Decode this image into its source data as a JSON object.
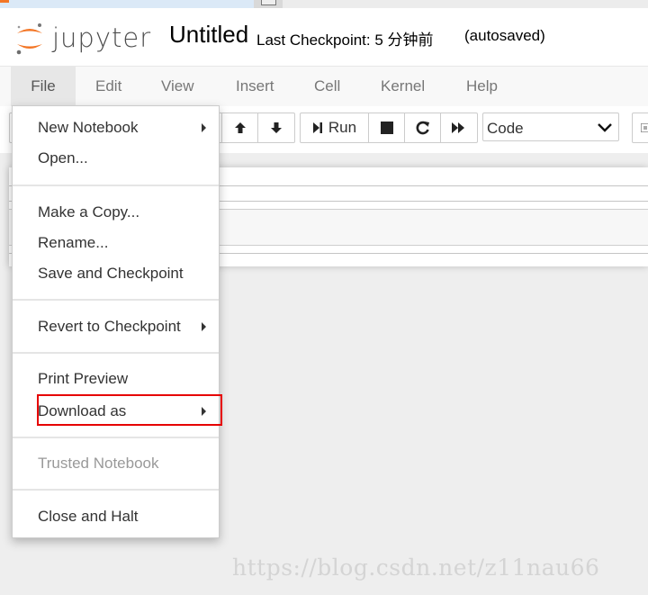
{
  "header": {
    "logo_text": "jupyter",
    "notebook_title": "Untitled",
    "checkpoint_status": "Last Checkpoint: 5 分钟前",
    "autosave_status": "(autosaved)"
  },
  "menubar": {
    "items": [
      {
        "label": "File",
        "active": true
      },
      {
        "label": "Edit"
      },
      {
        "label": "View"
      },
      {
        "label": "Insert"
      },
      {
        "label": "Cell"
      },
      {
        "label": "Kernel"
      },
      {
        "label": "Help"
      }
    ]
  },
  "toolbar": {
    "run_label": "Run",
    "cell_type_value": "Code",
    "icons": [
      "move-up-icon",
      "move-down-icon",
      "run-icon",
      "interrupt-icon",
      "restart-icon",
      "fast-forward-icon",
      "keyboard-icon"
    ]
  },
  "file_menu": {
    "items": [
      {
        "label": "New Notebook",
        "submenu": true
      },
      {
        "label": "Open..."
      },
      {
        "label": "Make a Copy..."
      },
      {
        "label": "Rename..."
      },
      {
        "label": "Save and Checkpoint"
      },
      {
        "label": "Revert to Checkpoint",
        "submenu": true
      },
      {
        "label": "Print Preview"
      },
      {
        "label": "Download as",
        "submenu": true,
        "highlighted": true
      },
      {
        "label": "Trusted Notebook",
        "disabled": true
      },
      {
        "label": "Close and Halt"
      }
    ]
  },
  "annotation": {
    "highlight_color": "#e60000"
  },
  "watermark": "https://blog.csdn.net/z11nau66",
  "colors": {
    "brand_orange": "#f37626",
    "menubar_bg": "#f8f8f8",
    "page_bg": "#eeeeee"
  }
}
